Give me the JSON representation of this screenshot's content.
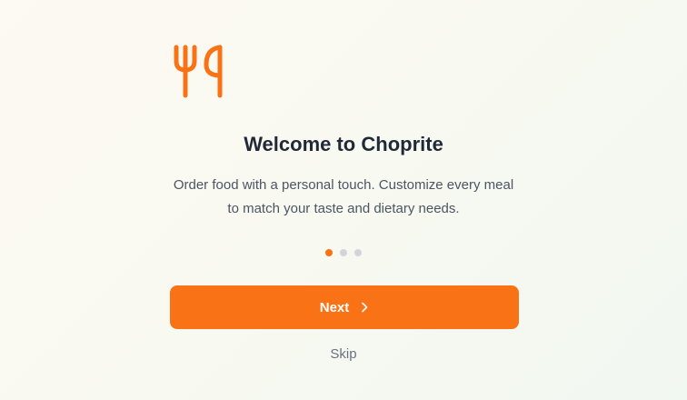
{
  "onboarding": {
    "logo_icon": "fork-knife-icon",
    "title": "Welcome to Choprite",
    "description": "Order food with a personal touch. Customize every meal to match your taste and dietary needs.",
    "pagination": {
      "total": 3,
      "active_index": 0
    },
    "next_label": "Next",
    "next_icon": "chevron-right-icon",
    "skip_label": "Skip"
  },
  "colors": {
    "accent": "#f97316",
    "title": "#1f2937",
    "body_text": "#4b5563",
    "muted": "#6b7280",
    "dot_inactive": "#d1d5db"
  }
}
